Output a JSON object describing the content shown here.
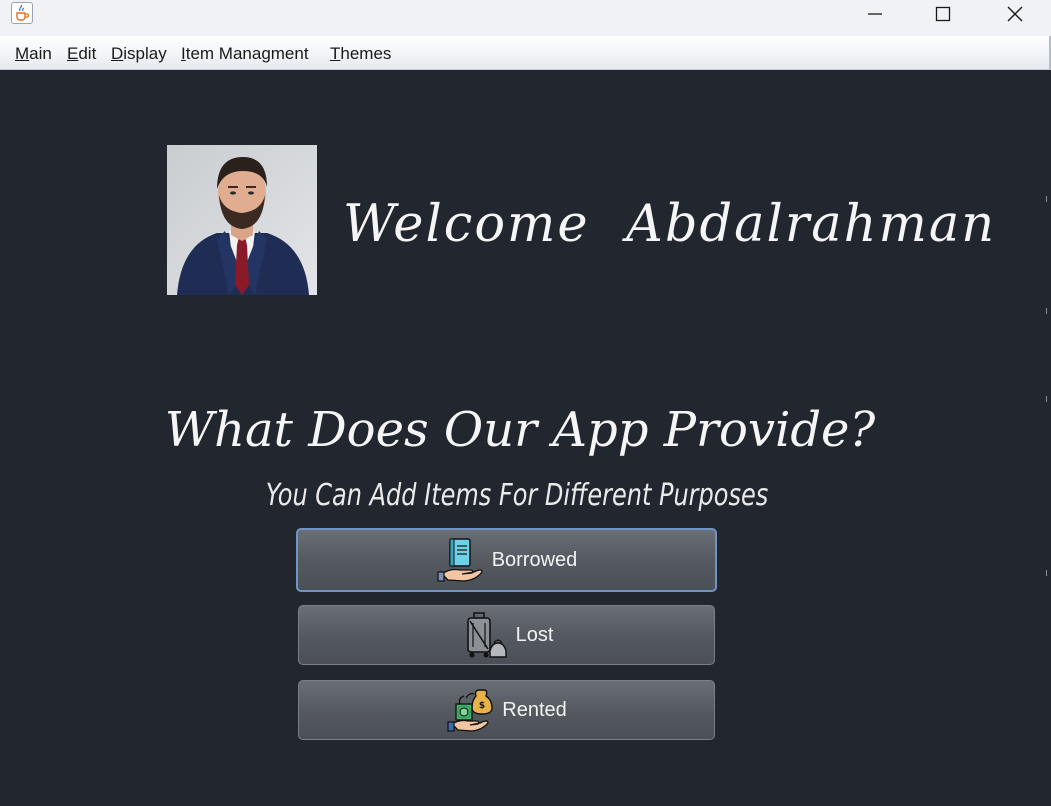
{
  "window": {
    "app_icon": "java-cup-icon",
    "controls": [
      "minimize-icon",
      "maximize-icon",
      "close-icon"
    ]
  },
  "menu": {
    "items": [
      {
        "mnemonic": "M",
        "rest": "ain"
      },
      {
        "mnemonic": "E",
        "rest": "dit"
      },
      {
        "mnemonic": "D",
        "rest": "isplay"
      },
      {
        "mnemonic": "I",
        "rest": "tem Managment"
      },
      {
        "mnemonic": "T",
        "rest": "hemes"
      }
    ]
  },
  "header": {
    "welcome": "Welcome  Abdalrahman"
  },
  "main": {
    "title": "What Does Our App Provide?",
    "subtitle": "You Can Add Items For Different Purposes",
    "buttons": [
      {
        "label": "Borrowed",
        "icon": "book-in-hand-icon"
      },
      {
        "label": "Lost",
        "icon": "lost-luggage-icon"
      },
      {
        "label": "Rented",
        "icon": "money-in-hand-icon"
      }
    ]
  },
  "colors": {
    "background": "#22262f",
    "text": "#f5f5f5",
    "button": "#5a5e66",
    "focus_ring": "#6f95c6"
  }
}
